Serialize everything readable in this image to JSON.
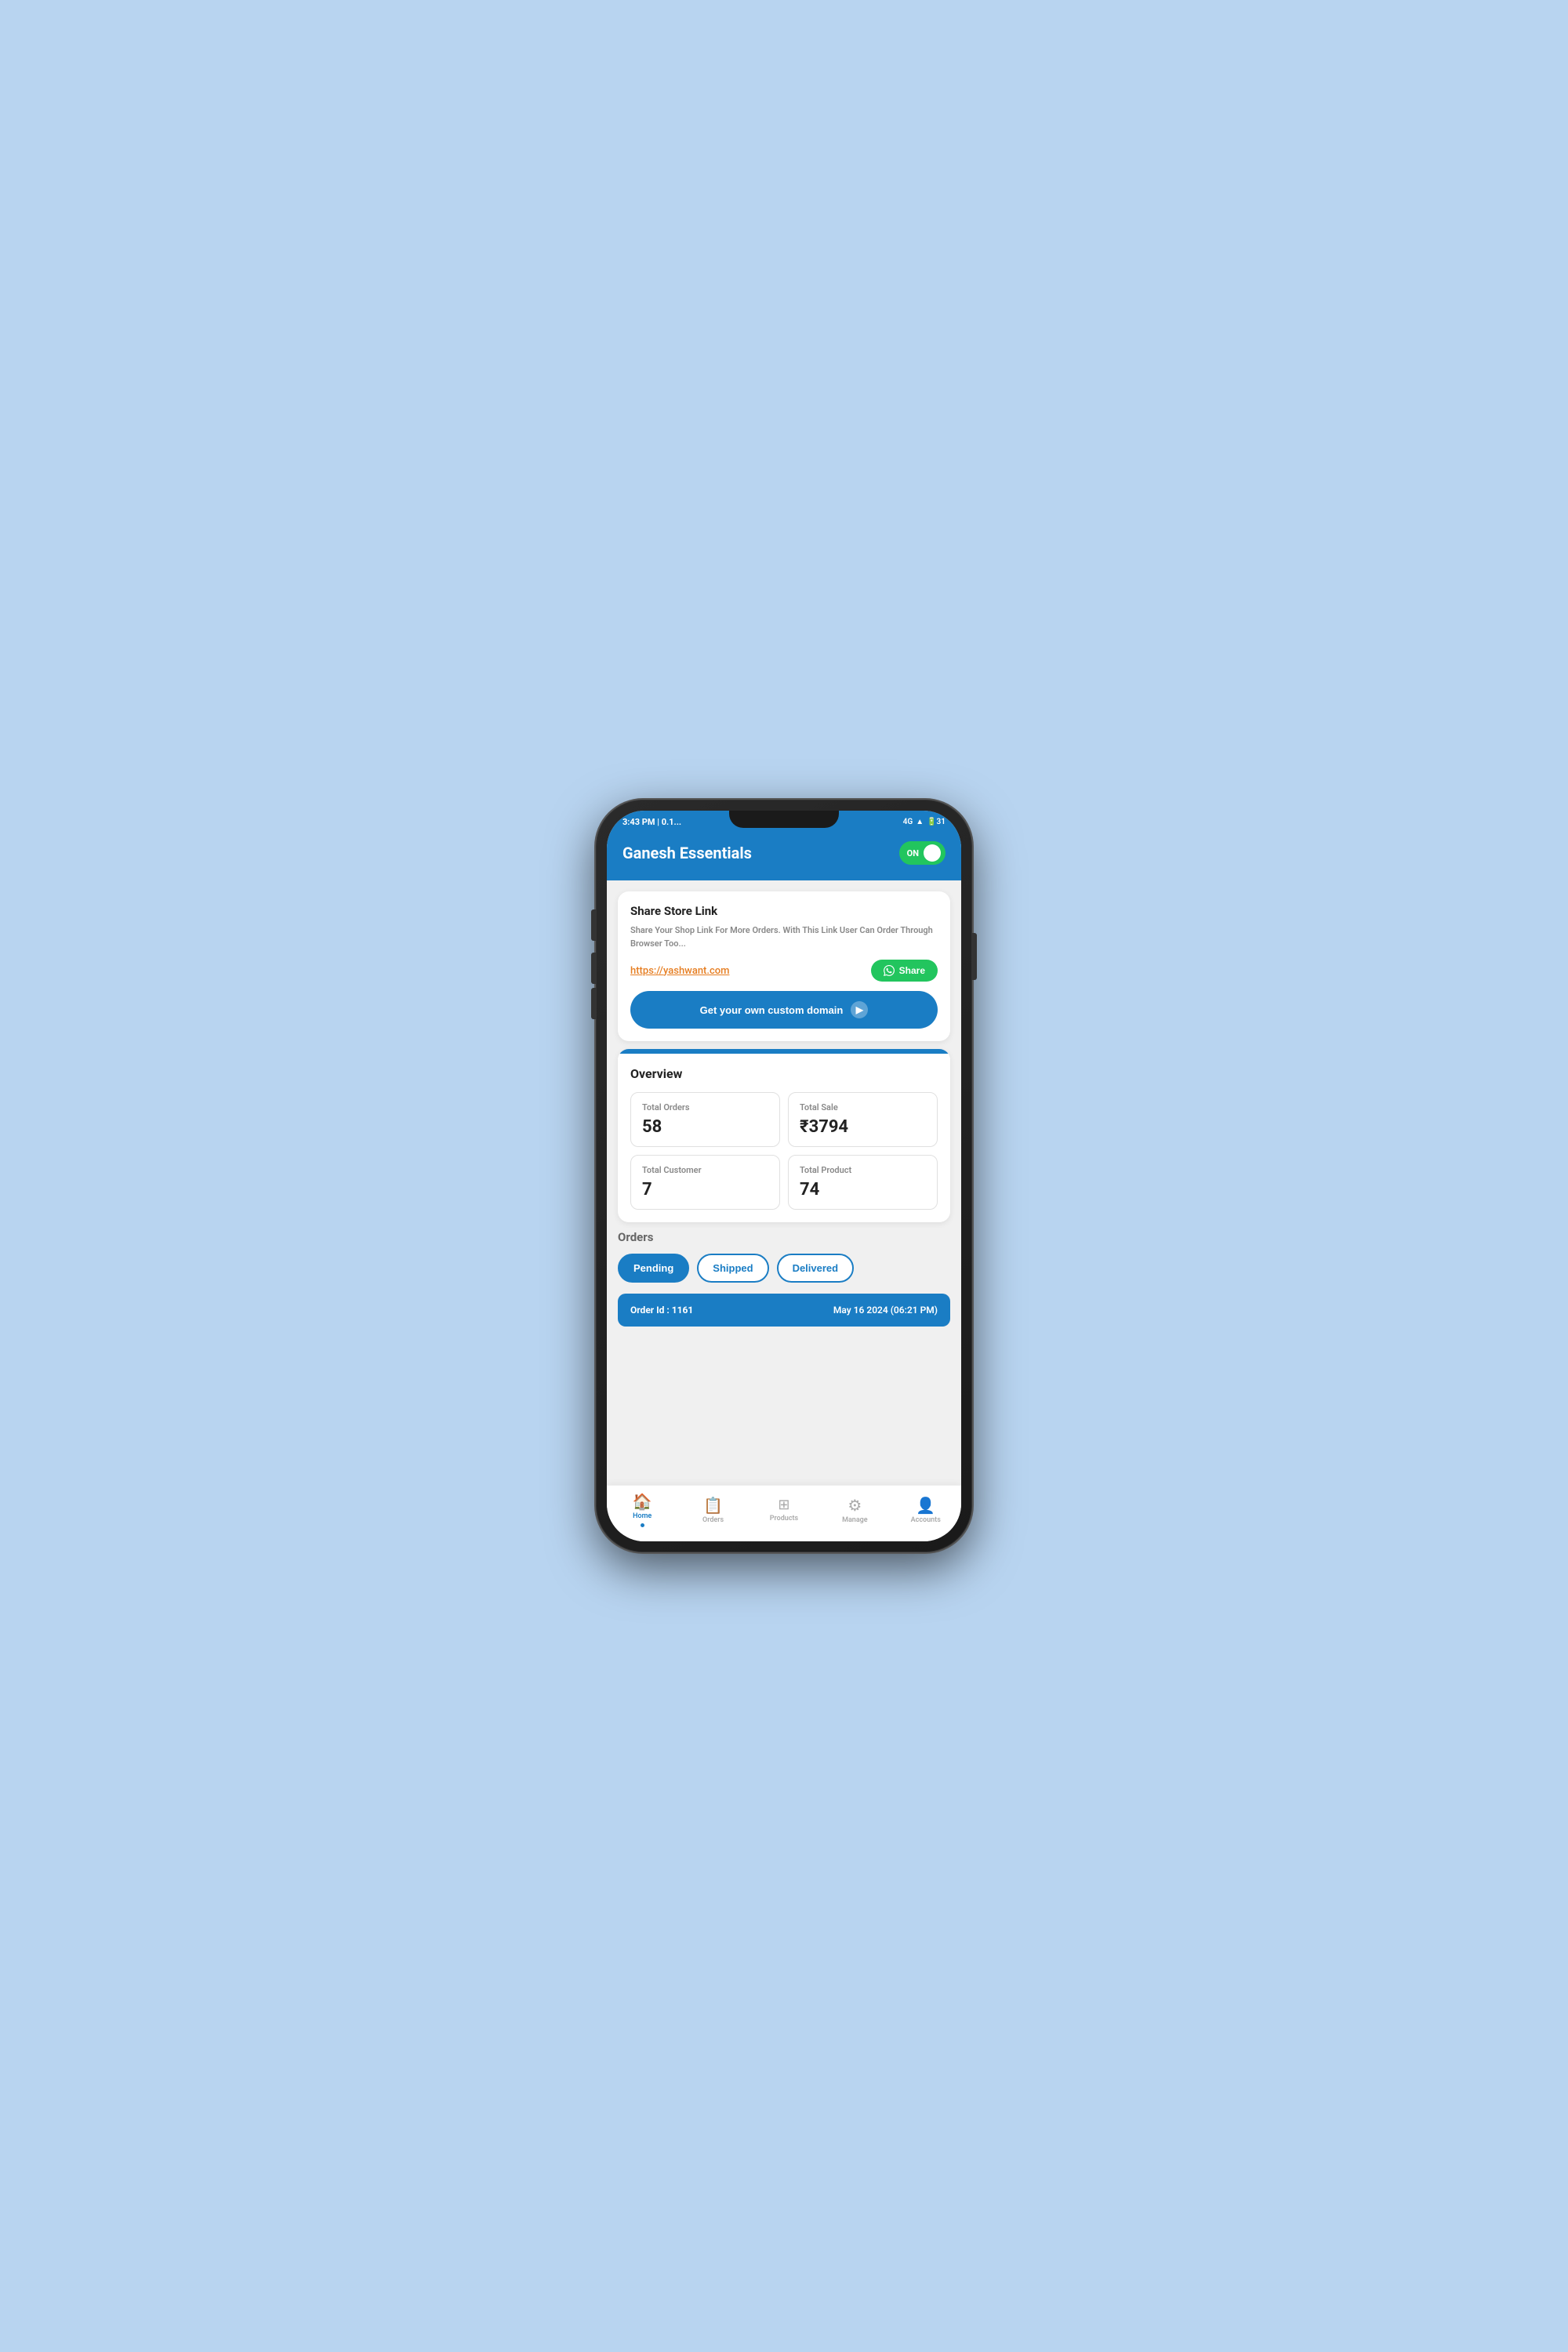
{
  "statusBar": {
    "time": "3:43 PM | 0.1...",
    "icons": "4G ▲▼ 🔋31"
  },
  "header": {
    "title": "Ganesh Essentials",
    "toggleLabel": "ON"
  },
  "shareCard": {
    "title": "Share Store Link",
    "description": "Share Your Shop Link For More Orders. With This Link User Can Order Through Browser Too...",
    "link": "https://yashwant.com",
    "shareButtonLabel": "Share",
    "customDomainLabel": "Get your own custom domain"
  },
  "overview": {
    "sectionTitle": "Overview",
    "stats": [
      {
        "label": "Total Orders",
        "value": "58"
      },
      {
        "label": "Total Sale",
        "value": "₹3794"
      },
      {
        "label": "Total Customer",
        "value": "7"
      },
      {
        "label": "Total Product",
        "value": "74"
      }
    ]
  },
  "orders": {
    "sectionTitle": "Orders",
    "tabs": [
      {
        "label": "Pending",
        "active": true
      },
      {
        "label": "Shipped",
        "active": false
      },
      {
        "label": "Delivered",
        "active": false
      }
    ],
    "orderCard": {
      "orderId": "Order Id : 1161",
      "orderDate": "May 16 2024 (06:21 PM)"
    }
  },
  "bottomNav": {
    "items": [
      {
        "label": "Home",
        "active": true,
        "icon": "🏠"
      },
      {
        "label": "Orders",
        "active": false,
        "icon": "📋"
      },
      {
        "label": "Products",
        "active": false,
        "icon": "⊞"
      },
      {
        "label": "Manage",
        "active": false,
        "icon": "⚙"
      },
      {
        "label": "Accounts",
        "active": false,
        "icon": "👤"
      }
    ]
  }
}
